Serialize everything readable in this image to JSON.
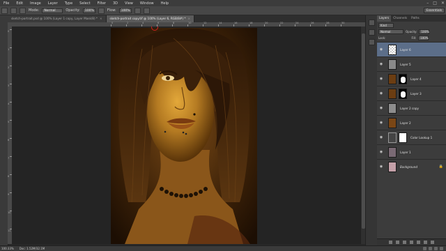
{
  "menu": [
    "File",
    "Edit",
    "Image",
    "Layer",
    "Type",
    "Select",
    "Filter",
    "3D",
    "View",
    "Window",
    "Help"
  ],
  "window_controls": [
    "–",
    "□",
    "✕"
  ],
  "options": {
    "mode_label": "Mode:",
    "mode_value": "Normal",
    "opacity_label": "Opacity:",
    "opacity_value": "100%",
    "flow_label": "Flow:",
    "flow_value": "100%",
    "workspace": "Essentials"
  },
  "tabs": [
    {
      "label": "sketch-portrait.psd @ 100% (Layer 1 copy, Layer Mask/8) *",
      "active": false
    },
    {
      "label": "sketch-portrait copy.tif @ 100% (Layer 6, RGB/8#) *",
      "active": true
    }
  ],
  "ruler_top": [
    "0",
    "2",
    "4",
    "6",
    "8",
    "10",
    "12",
    "14",
    "16",
    "18",
    "20",
    "22",
    "24",
    "26",
    "28",
    "30"
  ],
  "ruler_left": [
    "0",
    "1",
    "2",
    "3",
    "4",
    "5",
    "6",
    "7",
    "8",
    "9",
    "10",
    "11"
  ],
  "status": {
    "zoom": "100.33%",
    "doc": "Doc: 1.52M/32.1M"
  },
  "panel": {
    "tabs": [
      "Layers",
      "Channels",
      "Paths"
    ],
    "kind_label": "Kind",
    "blend_mode": "Normal",
    "opacity_label": "Opacity:",
    "opacity_value": "100%",
    "lock_label": "Lock:",
    "fill_label": "Fill:",
    "fill_value": "100%"
  },
  "layers": [
    {
      "name": "Layer 6",
      "thumb": "checker",
      "mask": false,
      "selected": true,
      "italic": false
    },
    {
      "name": "Layer 5",
      "thumb": "#8a8a8a",
      "mask": false,
      "selected": false,
      "italic": false
    },
    {
      "name": "Layer 4",
      "thumb": "#6b3d12",
      "mask": true,
      "selected": false,
      "italic": false
    },
    {
      "name": "Layer 3",
      "thumb": "#6b3d12",
      "mask": true,
      "selected": false,
      "italic": false
    },
    {
      "name": "Layer 2 copy",
      "thumb": "#8d8d8d",
      "mask": false,
      "selected": false,
      "italic": false
    },
    {
      "name": "Layer 2",
      "thumb": "#7a4615",
      "mask": false,
      "selected": false,
      "italic": false
    },
    {
      "name": "Color Lookup 1",
      "thumb": "adjust",
      "mask": true,
      "selected": false,
      "italic": false
    },
    {
      "name": "Layer 1",
      "thumb": "#7a6a74",
      "mask": false,
      "selected": false,
      "italic": false
    },
    {
      "name": "Background",
      "thumb": "#c4a0a8",
      "mask": false,
      "selected": false,
      "italic": true
    }
  ],
  "colors": {
    "selected_layer": "#5c6e89",
    "artwork_shadow": "#2a1505",
    "skin": "#c08a2a"
  }
}
